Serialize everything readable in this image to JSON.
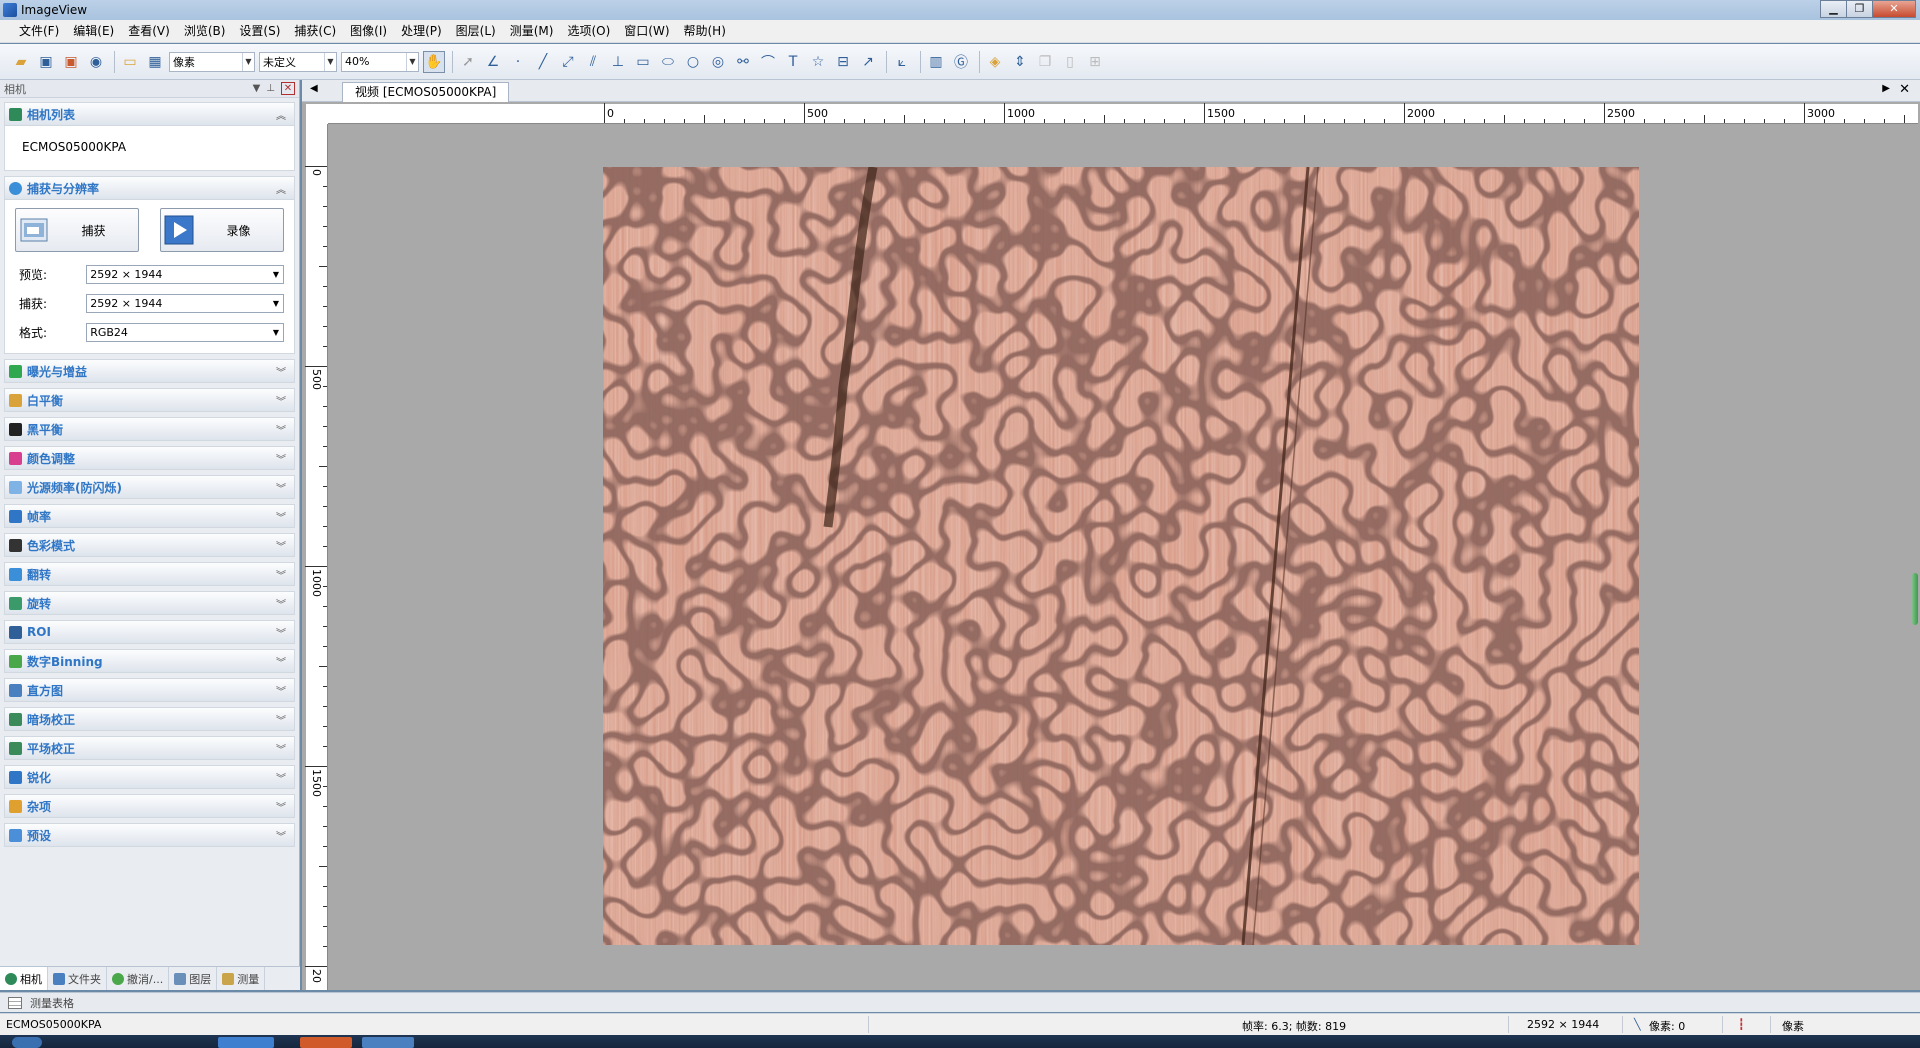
{
  "window": {
    "title": "ImageView"
  },
  "menu": [
    "文件(F)",
    "编辑(E)",
    "查看(V)",
    "浏览(B)",
    "设置(S)",
    "捕获(C)",
    "图像(I)",
    "处理(P)",
    "图层(L)",
    "测量(M)",
    "选项(O)",
    "窗口(W)",
    "帮助(H)"
  ],
  "toolbar": {
    "unit_select": "像素",
    "scale_select": "未定义",
    "zoom_select": "40%"
  },
  "left_panel": {
    "header": "相机",
    "camera_list": {
      "title": "相机列表",
      "item": "ECMOS05000KPA"
    },
    "capture": {
      "title": "捕获与分辨率",
      "capture_button": "捕获",
      "record_button": "录像",
      "preview_label": "预览:",
      "preview_value": "2592 × 1944",
      "capture_label": "捕获:",
      "capture_value": "2592 × 1944",
      "format_label": "格式:",
      "format_value": "RGB24"
    },
    "sections": [
      "曝光与增益",
      "白平衡",
      "黑平衡",
      "颜色调整",
      "光源频率(防闪烁)",
      "帧率",
      "色彩模式",
      "翻转",
      "旋转",
      "ROI",
      "数字Binning",
      "直方图",
      "暗场校正",
      "平场校正",
      "锐化",
      "杂项",
      "预设"
    ],
    "section_colors": [
      "#2fa84f",
      "#d9a23a",
      "#222222",
      "#d8408f",
      "#7fb3e6",
      "#2f76c6",
      "#333333",
      "#3a8fd8",
      "#3a9a6a",
      "#2f5f99",
      "#4aa84a",
      "#4a7fc0",
      "#3a8a5a",
      "#3a8a5a",
      "#2f76c6",
      "#e0a030",
      "#4a8fd8"
    ],
    "bottom_tabs": [
      "相机",
      "文件夹",
      "撤消/...",
      "图层",
      "测量"
    ]
  },
  "document": {
    "tab": "视频 [ECMOS05000KPA]",
    "h_ruler_labels": [
      "0",
      "500",
      "1000",
      "1500",
      "2000",
      "2500",
      "3000"
    ],
    "v_ruler_labels": [
      "0",
      "500",
      "1000",
      "1500",
      "20"
    ]
  },
  "measure_sheet": {
    "label": "测量表格"
  },
  "status": {
    "camera": "ECMOS05000KPA",
    "fps": "帧率: 6.3; 帧数: 819",
    "resolution": "2592 × 1944",
    "pixel": "像素: 0",
    "unit": "像素"
  }
}
